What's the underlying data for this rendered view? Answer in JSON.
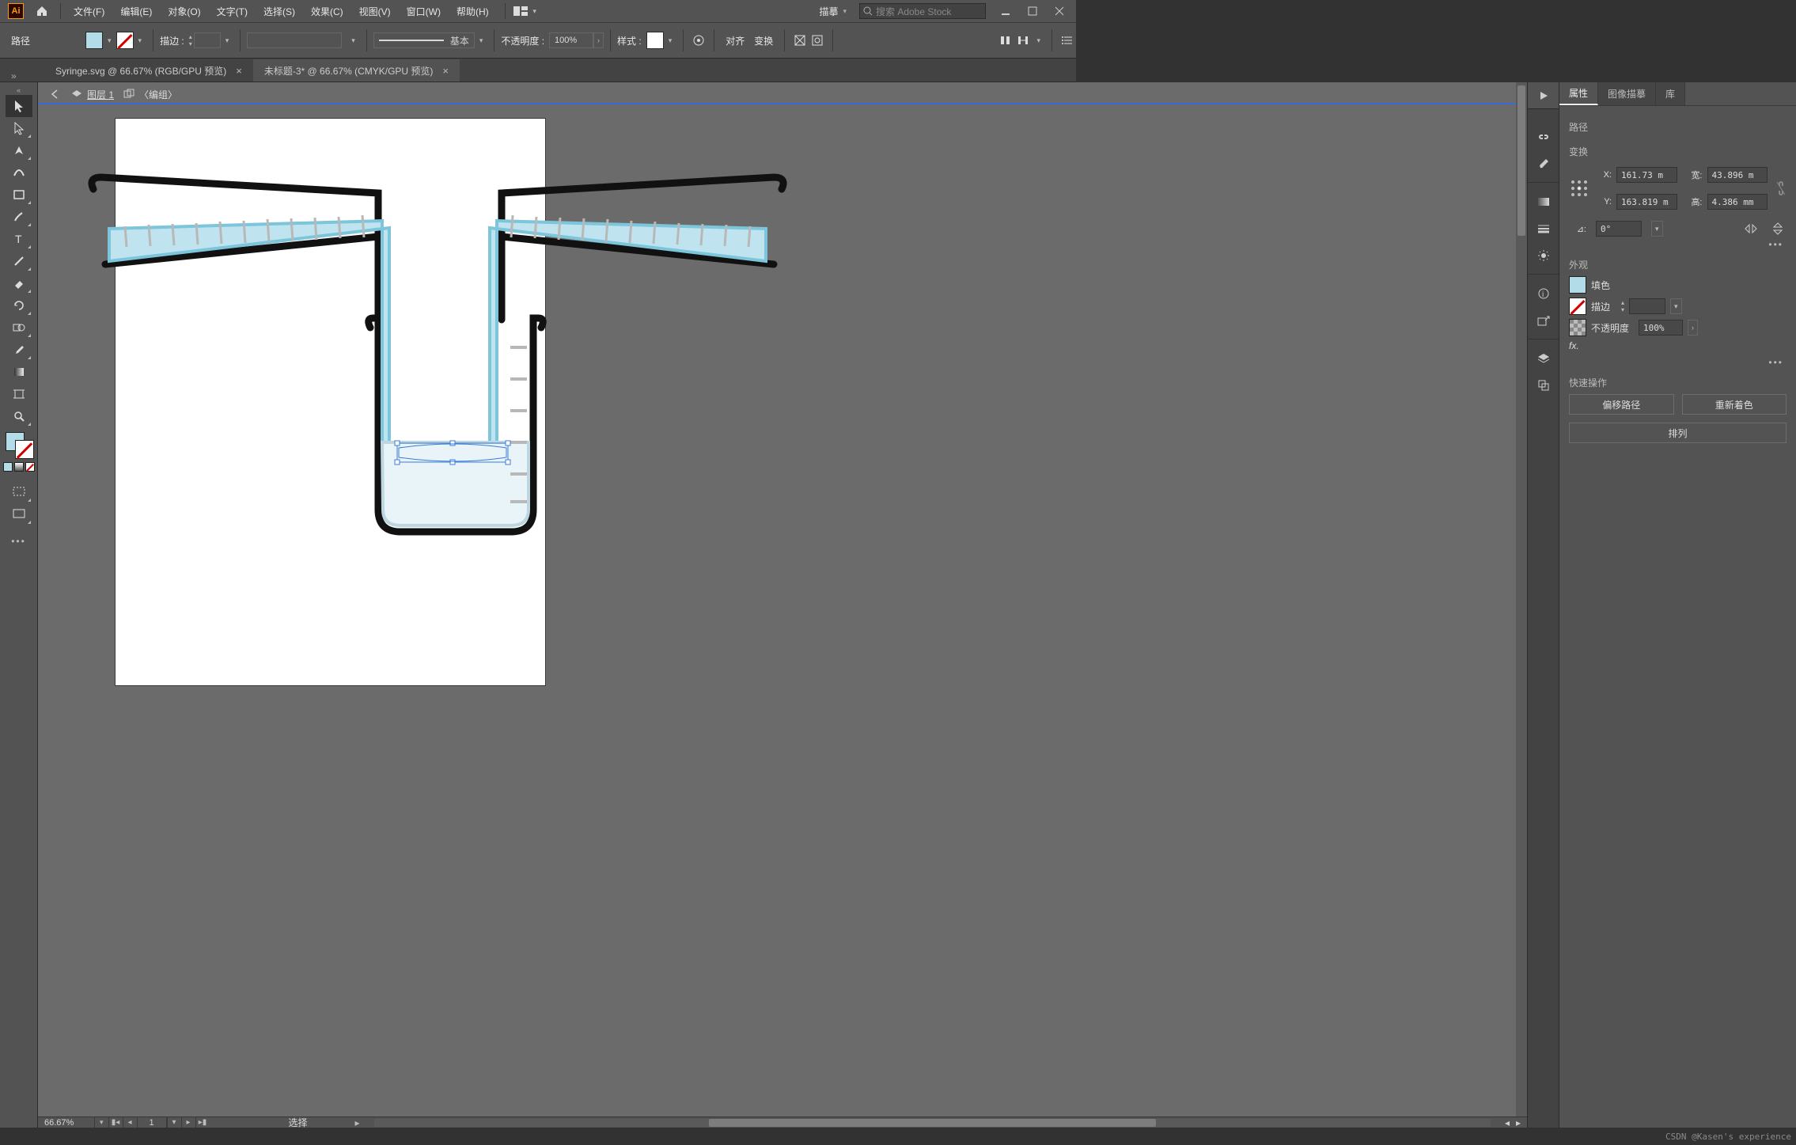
{
  "menubar": {
    "file": "文件(F)",
    "edit": "编辑(E)",
    "object": "对象(O)",
    "type": "文字(T)",
    "select": "选择(S)",
    "effect": "效果(C)",
    "view": "视图(V)",
    "window": "窗口(W)",
    "help": "帮助(H)",
    "trace": "描摹",
    "search_placeholder": "搜索 Adobe Stock"
  },
  "controlbar": {
    "mode": "路径",
    "stroke_label": "描边 :",
    "stroke_pt": "",
    "stroke_style": "基本",
    "opacity_label": "不透明度 :",
    "opacity_value": "100%",
    "style_label": "样式 :",
    "align": "对齐",
    "transform": "变换"
  },
  "tabs": {
    "t1": "Syringe.svg @ 66.67% (RGB/GPU 预览)",
    "t2": "未标题-3* @ 66.67% (CMYK/GPU 预览)"
  },
  "breadcrumb": {
    "layer_label": "图层 1",
    "group": "编组"
  },
  "statusbar": {
    "zoom": "66.67%",
    "artboard": "1",
    "sel": "选择"
  },
  "props": {
    "tab_props": "属性",
    "tab_trace": "图像描摹",
    "tab_libs": "库",
    "kind": "路径",
    "sec_transform": "变换",
    "x_label": "X:",
    "x_val": "161.73 m",
    "y_label": "Y:",
    "y_val": "163.819 m",
    "w_label": "宽:",
    "w_val": "43.896 m",
    "h_label": "高:",
    "h_val": "4.386 mm",
    "angle_label": "⊿:",
    "angle_val": "0°",
    "sec_appearance": "外观",
    "fill_label": "填色",
    "stroke_label": "描边",
    "stroke_val": "",
    "opac_label": "不透明度",
    "opac_val": "100%",
    "fx": "fx.",
    "sec_quick": "快速操作",
    "offset": "偏移路径",
    "recolor": "重新着色",
    "arrange": "排列"
  },
  "watermark": "CSDN @Kasen's experience"
}
